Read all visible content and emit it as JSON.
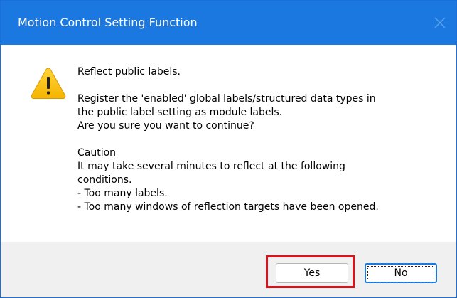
{
  "window": {
    "title": "Motion Control Setting Function",
    "close_icon": "close-icon",
    "accent_color": "#1b78e0"
  },
  "message": {
    "icon": "warning-icon",
    "heading": "Reflect public labels.",
    "body_lines": [
      "Register the 'enabled' global labels/structured data types in",
      "the public label setting as module labels.",
      "Are you sure you want to continue?"
    ],
    "caution_title": "Caution",
    "caution_lines": [
      "It may take several minutes to reflect at the following",
      "conditions.",
      "- Too many labels.",
      "- Too many windows of reflection targets have been opened."
    ]
  },
  "buttons": {
    "yes_label": "Yes",
    "yes_mnemonic": "Y",
    "yes_rest": "es",
    "no_label": "No",
    "no_mnemonic": "N",
    "no_rest": "o",
    "highlight_color": "#e0101a"
  }
}
